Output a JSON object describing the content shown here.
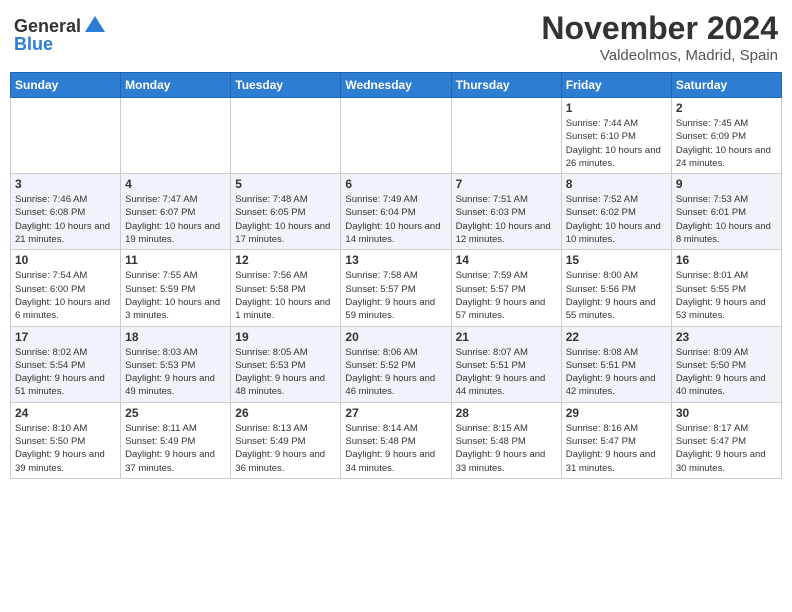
{
  "header": {
    "logo_line1": "General",
    "logo_line2": "Blue",
    "month_title": "November 2024",
    "location": "Valdeolmos, Madrid, Spain"
  },
  "weekdays": [
    "Sunday",
    "Monday",
    "Tuesday",
    "Wednesday",
    "Thursday",
    "Friday",
    "Saturday"
  ],
  "weeks": [
    [
      {
        "day": "",
        "info": ""
      },
      {
        "day": "",
        "info": ""
      },
      {
        "day": "",
        "info": ""
      },
      {
        "day": "",
        "info": ""
      },
      {
        "day": "",
        "info": ""
      },
      {
        "day": "1",
        "info": "Sunrise: 7:44 AM\nSunset: 6:10 PM\nDaylight: 10 hours and 26 minutes."
      },
      {
        "day": "2",
        "info": "Sunrise: 7:45 AM\nSunset: 6:09 PM\nDaylight: 10 hours and 24 minutes."
      }
    ],
    [
      {
        "day": "3",
        "info": "Sunrise: 7:46 AM\nSunset: 6:08 PM\nDaylight: 10 hours and 21 minutes."
      },
      {
        "day": "4",
        "info": "Sunrise: 7:47 AM\nSunset: 6:07 PM\nDaylight: 10 hours and 19 minutes."
      },
      {
        "day": "5",
        "info": "Sunrise: 7:48 AM\nSunset: 6:05 PM\nDaylight: 10 hours and 17 minutes."
      },
      {
        "day": "6",
        "info": "Sunrise: 7:49 AM\nSunset: 6:04 PM\nDaylight: 10 hours and 14 minutes."
      },
      {
        "day": "7",
        "info": "Sunrise: 7:51 AM\nSunset: 6:03 PM\nDaylight: 10 hours and 12 minutes."
      },
      {
        "day": "8",
        "info": "Sunrise: 7:52 AM\nSunset: 6:02 PM\nDaylight: 10 hours and 10 minutes."
      },
      {
        "day": "9",
        "info": "Sunrise: 7:53 AM\nSunset: 6:01 PM\nDaylight: 10 hours and 8 minutes."
      }
    ],
    [
      {
        "day": "10",
        "info": "Sunrise: 7:54 AM\nSunset: 6:00 PM\nDaylight: 10 hours and 6 minutes."
      },
      {
        "day": "11",
        "info": "Sunrise: 7:55 AM\nSunset: 5:59 PM\nDaylight: 10 hours and 3 minutes."
      },
      {
        "day": "12",
        "info": "Sunrise: 7:56 AM\nSunset: 5:58 PM\nDaylight: 10 hours and 1 minute."
      },
      {
        "day": "13",
        "info": "Sunrise: 7:58 AM\nSunset: 5:57 PM\nDaylight: 9 hours and 59 minutes."
      },
      {
        "day": "14",
        "info": "Sunrise: 7:59 AM\nSunset: 5:57 PM\nDaylight: 9 hours and 57 minutes."
      },
      {
        "day": "15",
        "info": "Sunrise: 8:00 AM\nSunset: 5:56 PM\nDaylight: 9 hours and 55 minutes."
      },
      {
        "day": "16",
        "info": "Sunrise: 8:01 AM\nSunset: 5:55 PM\nDaylight: 9 hours and 53 minutes."
      }
    ],
    [
      {
        "day": "17",
        "info": "Sunrise: 8:02 AM\nSunset: 5:54 PM\nDaylight: 9 hours and 51 minutes."
      },
      {
        "day": "18",
        "info": "Sunrise: 8:03 AM\nSunset: 5:53 PM\nDaylight: 9 hours and 49 minutes."
      },
      {
        "day": "19",
        "info": "Sunrise: 8:05 AM\nSunset: 5:53 PM\nDaylight: 9 hours and 48 minutes."
      },
      {
        "day": "20",
        "info": "Sunrise: 8:06 AM\nSunset: 5:52 PM\nDaylight: 9 hours and 46 minutes."
      },
      {
        "day": "21",
        "info": "Sunrise: 8:07 AM\nSunset: 5:51 PM\nDaylight: 9 hours and 44 minutes."
      },
      {
        "day": "22",
        "info": "Sunrise: 8:08 AM\nSunset: 5:51 PM\nDaylight: 9 hours and 42 minutes."
      },
      {
        "day": "23",
        "info": "Sunrise: 8:09 AM\nSunset: 5:50 PM\nDaylight: 9 hours and 40 minutes."
      }
    ],
    [
      {
        "day": "24",
        "info": "Sunrise: 8:10 AM\nSunset: 5:50 PM\nDaylight: 9 hours and 39 minutes."
      },
      {
        "day": "25",
        "info": "Sunrise: 8:11 AM\nSunset: 5:49 PM\nDaylight: 9 hours and 37 minutes."
      },
      {
        "day": "26",
        "info": "Sunrise: 8:13 AM\nSunset: 5:49 PM\nDaylight: 9 hours and 36 minutes."
      },
      {
        "day": "27",
        "info": "Sunrise: 8:14 AM\nSunset: 5:48 PM\nDaylight: 9 hours and 34 minutes."
      },
      {
        "day": "28",
        "info": "Sunrise: 8:15 AM\nSunset: 5:48 PM\nDaylight: 9 hours and 33 minutes."
      },
      {
        "day": "29",
        "info": "Sunrise: 8:16 AM\nSunset: 5:47 PM\nDaylight: 9 hours and 31 minutes."
      },
      {
        "day": "30",
        "info": "Sunrise: 8:17 AM\nSunset: 5:47 PM\nDaylight: 9 hours and 30 minutes."
      }
    ]
  ]
}
